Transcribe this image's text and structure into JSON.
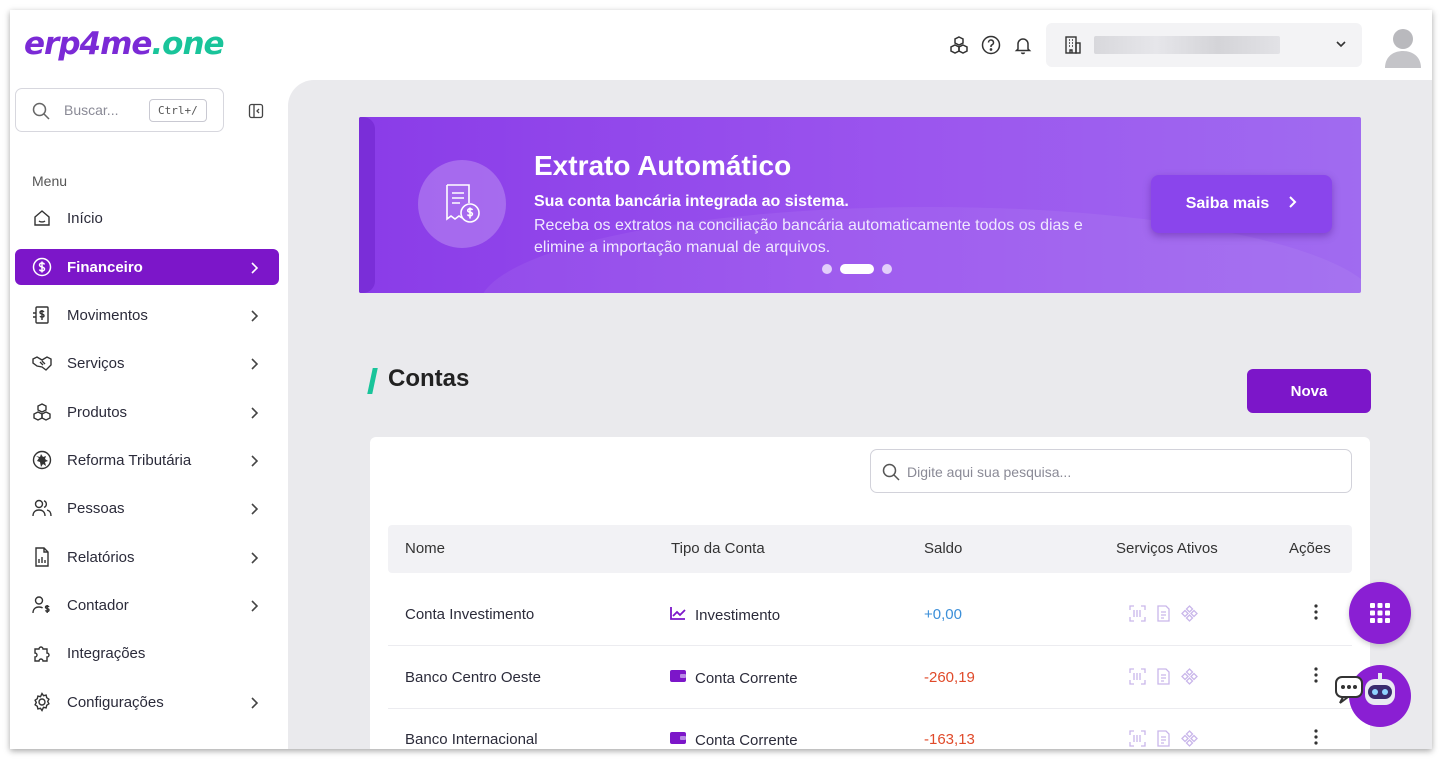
{
  "app": {
    "logo_part1": "erp4me",
    "logo_part2": ".one"
  },
  "header": {
    "icons": [
      "modules-icon",
      "help-icon",
      "bell-icon"
    ],
    "company_selector": "building-icon"
  },
  "sidebar": {
    "search_placeholder": "Buscar...",
    "search_shortcut": "Ctrl+/",
    "menu_label": "Menu",
    "items": [
      {
        "label": "Início",
        "icon": "home-icon",
        "has_arrow": false,
        "active": false
      },
      {
        "label": "Financeiro",
        "icon": "dollar-icon",
        "has_arrow": true,
        "active": true
      },
      {
        "label": "Movimentos",
        "icon": "movements-icon",
        "has_arrow": true,
        "active": false
      },
      {
        "label": "Serviços",
        "icon": "handshake-icon",
        "has_arrow": true,
        "active": false
      },
      {
        "label": "Produtos",
        "icon": "boxes-icon",
        "has_arrow": true,
        "active": false
      },
      {
        "label": "Reforma Tributária",
        "icon": "lion-icon",
        "has_arrow": true,
        "active": false
      },
      {
        "label": "Pessoas",
        "icon": "people-icon",
        "has_arrow": true,
        "active": false
      },
      {
        "label": "Relatórios",
        "icon": "report-icon",
        "has_arrow": true,
        "active": false
      },
      {
        "label": "Contador",
        "icon": "accountant-icon",
        "has_arrow": true,
        "active": false
      },
      {
        "label": "Integrações",
        "icon": "puzzle-icon",
        "has_arrow": false,
        "active": false
      },
      {
        "label": "Configurações",
        "icon": "gear-icon",
        "has_arrow": true,
        "active": false
      }
    ]
  },
  "banner": {
    "title": "Extrato Automático",
    "subtitle": "Sua conta bancária integrada ao sistema.",
    "description": "Receba os extratos na conciliação bancária automaticamente todos os dias e elimine a importação manual de arquivos.",
    "button": "Saiba mais",
    "slides": 3,
    "active_slide": 2
  },
  "contas": {
    "title": "Contas",
    "new_button": "Nova",
    "search_placeholder": "Digite aqui sua pesquisa...",
    "columns": [
      "Nome",
      "Tipo da Conta",
      "Saldo",
      "Serviços Ativos",
      "Ações"
    ],
    "rows": [
      {
        "nome": "Conta Investimento",
        "tipo": "Investimento",
        "tipo_icon": "chart-line-icon",
        "saldo": "+0,00",
        "saldo_sign": "positive"
      },
      {
        "nome": "Banco Centro Oeste",
        "tipo": "Conta Corrente",
        "tipo_icon": "wallet-icon",
        "saldo": "-260,19",
        "saldo_sign": "negative"
      },
      {
        "nome": "Banco Internacional",
        "tipo": "Conta Corrente",
        "tipo_icon": "wallet-icon",
        "saldo": "-163,13",
        "saldo_sign": "negative"
      }
    ]
  },
  "colors": {
    "primary": "#7c16c9",
    "accent": "#19c49a",
    "positive": "#3b8fd9",
    "negative": "#e04a2a"
  }
}
